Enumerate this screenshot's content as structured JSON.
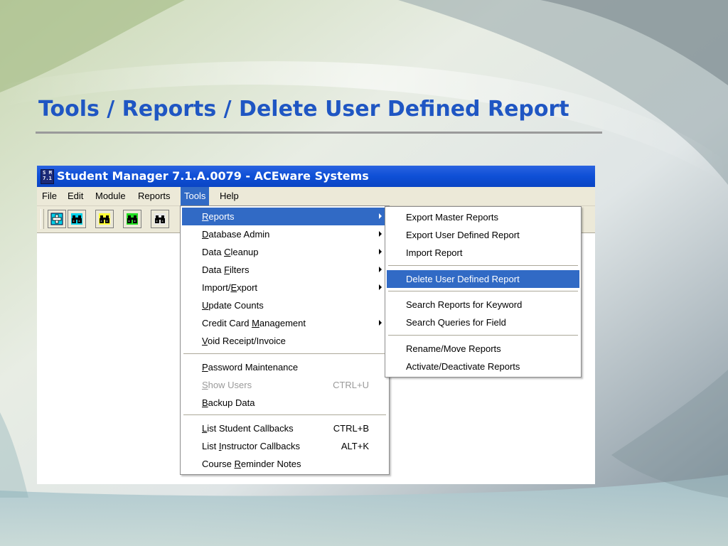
{
  "slide": {
    "title": "Tools / Reports / Delete User Defined Report"
  },
  "window": {
    "title": "Student Manager 7.1.A.0079 - ACEware Systems",
    "icon_text_top": "S M",
    "icon_text_bottom": "7.1"
  },
  "menubar": {
    "items": [
      "File",
      "Edit",
      "Module",
      "Reports",
      "Tools",
      "Help"
    ],
    "active": "Tools"
  },
  "toolbar": {
    "buttons": [
      "add-icon",
      "binoculars-icon",
      "binoculars-icon",
      "binoculars-icon",
      "binoculars-icon"
    ]
  },
  "tools_menu": {
    "items": [
      {
        "label": "Reports",
        "mnemonic": "R",
        "submenu": true,
        "selected": true
      },
      {
        "label": "Database Admin",
        "mnemonic": "D",
        "submenu": true
      },
      {
        "label": "Data Cleanup",
        "mnemonic": "C",
        "submenu": true
      },
      {
        "label": "Data Filters",
        "mnemonic": "F",
        "submenu": true
      },
      {
        "label": "Import/Export",
        "mnemonic": "E",
        "submenu": true
      },
      {
        "label": "Update Counts",
        "mnemonic": "U"
      },
      {
        "label": "Credit Card Management",
        "mnemonic": "M",
        "submenu": true
      },
      {
        "label": "Void Receipt/Invoice",
        "mnemonic": "V"
      },
      {
        "label": "Password Maintenance",
        "mnemonic": "P"
      },
      {
        "label": "Show Users",
        "mnemonic": "S",
        "shortcut": "CTRL+U",
        "disabled": true
      },
      {
        "label": "Backup Data",
        "mnemonic": "B"
      },
      {
        "label": "List Student Callbacks",
        "mnemonic": "L",
        "shortcut": "CTRL+B"
      },
      {
        "label": "List Instructor Callbacks",
        "mnemonic": "I",
        "shortcut": "ALT+K"
      },
      {
        "label": "Course Reminder Notes",
        "mnemonic": "R"
      }
    ]
  },
  "reports_submenu": {
    "items": [
      {
        "label": "Export Master Reports"
      },
      {
        "label": "Export User Defined Report"
      },
      {
        "label": "Import Report"
      },
      {
        "label": "Delete User Defined Report",
        "selected": true
      },
      {
        "label": "Search Reports for Keyword"
      },
      {
        "label": "Search Queries for Field"
      },
      {
        "label": "Rename/Move Reports"
      },
      {
        "label": "Activate/Deactivate Reports"
      }
    ]
  },
  "colors": {
    "title_blue": "#1f56c3",
    "menu_highlight": "#316ac5",
    "window_title_bar": "#0e4fd6",
    "menu_background": "#ece9d8"
  }
}
